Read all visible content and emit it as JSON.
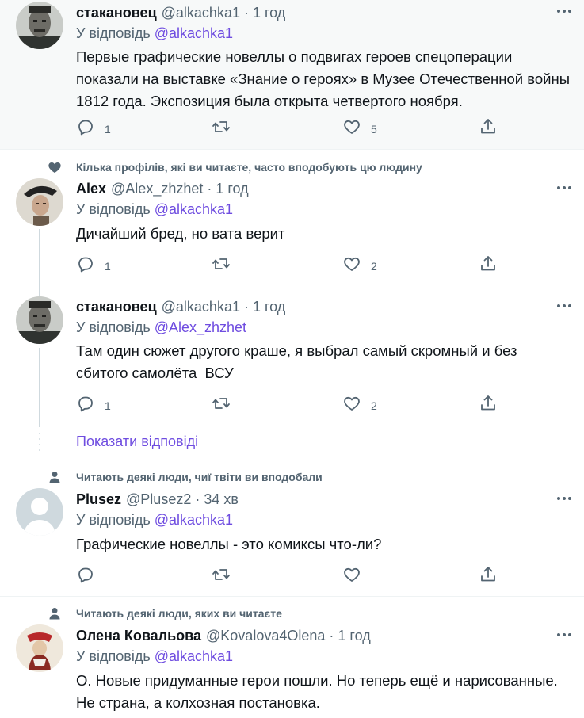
{
  "tweets": [
    {
      "name": "стакановец",
      "handle": "@alkachka1",
      "time": "1 год",
      "reply_prefix": "У відповідь",
      "reply_to": "@alkachka1",
      "text_lines": [
        "Первые графические новеллы о подвигах героев спецоперации",
        "показали на выставке «Знание о героях» в Музее Отечественной войны",
        "1812 года. Экспозиция была открыта четвертого ноября."
      ],
      "replies": "1",
      "retweets": "",
      "likes": "5"
    },
    {
      "social_context": "Кілька профілів, які ви читаєте, часто вподобують цю людину",
      "name": "Alex",
      "handle": "@Alex_zhzhet",
      "time": "1 год",
      "reply_prefix": "У відповідь",
      "reply_to": "@alkachka1",
      "text_lines": [
        "Дичайший бред, но вата верит"
      ],
      "replies": "1",
      "retweets": "",
      "likes": "2"
    },
    {
      "name": "стакановец",
      "handle": "@alkachka1",
      "time": "1 год",
      "reply_prefix": "У відповідь",
      "reply_to": "@Alex_zhzhet",
      "text_lines": [
        "Там один сюжет другого краше, я выбрал самый скромный и без",
        "сбитого самолёта  ВСУ"
      ],
      "replies": "1",
      "retweets": "",
      "likes": "2"
    },
    {
      "social_context": "Читають деякі люди, чиї твіти ви вподобали",
      "name": "Plusez",
      "handle": "@Plusez2",
      "time": "34 хв",
      "reply_prefix": "У відповідь",
      "reply_to": "@alkachka1",
      "text_lines": [
        "Графические новеллы - это комиксы что-ли?"
      ],
      "replies": "",
      "retweets": "",
      "likes": ""
    },
    {
      "social_context": "Читають деякі люди, яких ви читаєте",
      "name": "Олена Ковальова",
      "handle": "@Kovalova4Olena",
      "time": "1 год",
      "reply_prefix": "У відповідь",
      "reply_to": "@alkachka1",
      "text_lines": [
        "О. Новые придуманные герои пошли. Но теперь ещё и нарисованные.",
        "Не страна, а колхозная постановка."
      ],
      "replies": "",
      "retweets": "",
      "likes": ""
    }
  ],
  "show_replies_label": "Показати відповіді",
  "colors": {
    "accent": "#6f4de0",
    "muted": "#536471",
    "text": "#0f1419",
    "highlight_bg": "#f7f9f9",
    "divider": "#eff3f4"
  }
}
